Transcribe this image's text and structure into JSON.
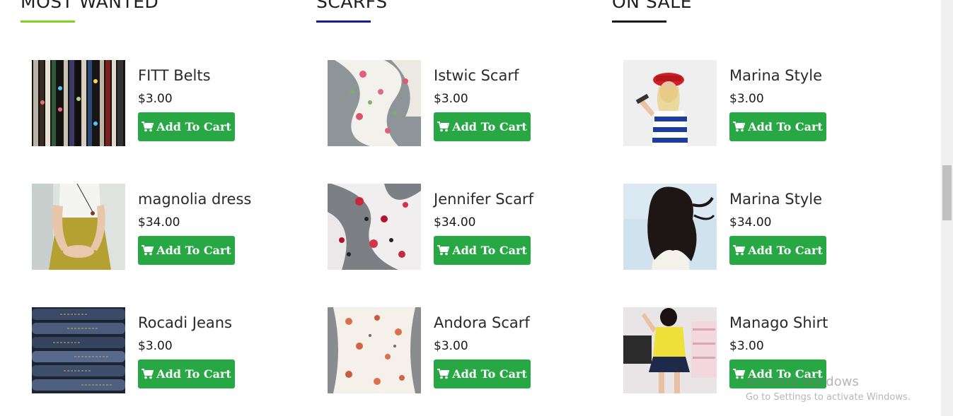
{
  "colors": {
    "button_green": "#28a745",
    "underline_most_wanted": "#7ed321",
    "underline_scarfs": "#1a1a99",
    "underline_on_sale": "#1a1a1a"
  },
  "columns": [
    {
      "heading": "MOST WANTED",
      "products": [
        {
          "name": "FITT Belts",
          "price": "$3.00",
          "button": "Add To Cart",
          "image_icon": "belts-photo"
        },
        {
          "name": "magnolia dress",
          "price": "$34.00",
          "button": "Add To Cart",
          "image_icon": "dress-photo"
        },
        {
          "name": "Rocadi Jeans",
          "price": "$3.00",
          "button": "Add To Cart",
          "image_icon": "jeans-photo"
        }
      ]
    },
    {
      "heading": "SCARFS",
      "products": [
        {
          "name": "Istwic Scarf",
          "price": "$3.00",
          "button": "Add To Cart",
          "image_icon": "scarf-photo"
        },
        {
          "name": "Jennifer Scarf",
          "price": "$34.00",
          "button": "Add To Cart",
          "image_icon": "scarf-photo"
        },
        {
          "name": "Andora Scarf",
          "price": "$3.00",
          "button": "Add To Cart",
          "image_icon": "scarf-photo"
        }
      ]
    },
    {
      "heading": "ON SALE",
      "products": [
        {
          "name": "Marina Style",
          "price": "$3.00",
          "button": "Add To Cart",
          "image_icon": "model-photo"
        },
        {
          "name": "Marina Style",
          "price": "$34.00",
          "button": "Add To Cart",
          "image_icon": "model-photo"
        },
        {
          "name": "Manago Shirt",
          "price": "$3.00",
          "button": "Add To Cart",
          "image_icon": "model-photo"
        }
      ]
    }
  ],
  "button_icon": "shopping-cart-icon",
  "watermark": {
    "title": "Activate Windows",
    "subtitle": "Go to Settings to activate Windows."
  }
}
